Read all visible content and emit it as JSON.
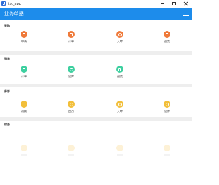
{
  "window": {
    "title": "jxc_app"
  },
  "appbar": {
    "title": "业务单据"
  },
  "sections": [
    {
      "title": "采购",
      "items": [
        {
          "label": "申请",
          "icon": "cart-icon",
          "color": "#ef7a3a"
        },
        {
          "label": "订单",
          "icon": "order-icon",
          "color": "#ef7a3a"
        },
        {
          "label": "入库",
          "icon": "stock-in-icon",
          "color": "#ef7a3a"
        },
        {
          "label": "退货",
          "icon": "return-icon",
          "color": "#ef7a3a"
        }
      ]
    },
    {
      "title": "销售",
      "items": [
        {
          "label": "订单",
          "icon": "order-icon",
          "color": "#3ed0a0"
        },
        {
          "label": "出库",
          "icon": "stock-out-icon",
          "color": "#3ed0a0"
        },
        {
          "label": "退货",
          "icon": "return-icon",
          "color": "#3ed0a0"
        }
      ]
    },
    {
      "title": "库存",
      "items": [
        {
          "label": "调拨",
          "icon": "transfer-icon",
          "color": "#f2bf3a"
        },
        {
          "label": "盘点",
          "icon": "inventory-icon",
          "color": "#f2bf3a"
        },
        {
          "label": "入库",
          "icon": "stock-in-icon",
          "color": "#f2bf3a"
        },
        {
          "label": "出库",
          "icon": "stock-out-icon",
          "color": "#f2bf3a"
        }
      ]
    },
    {
      "title": "财务",
      "items": []
    }
  ]
}
